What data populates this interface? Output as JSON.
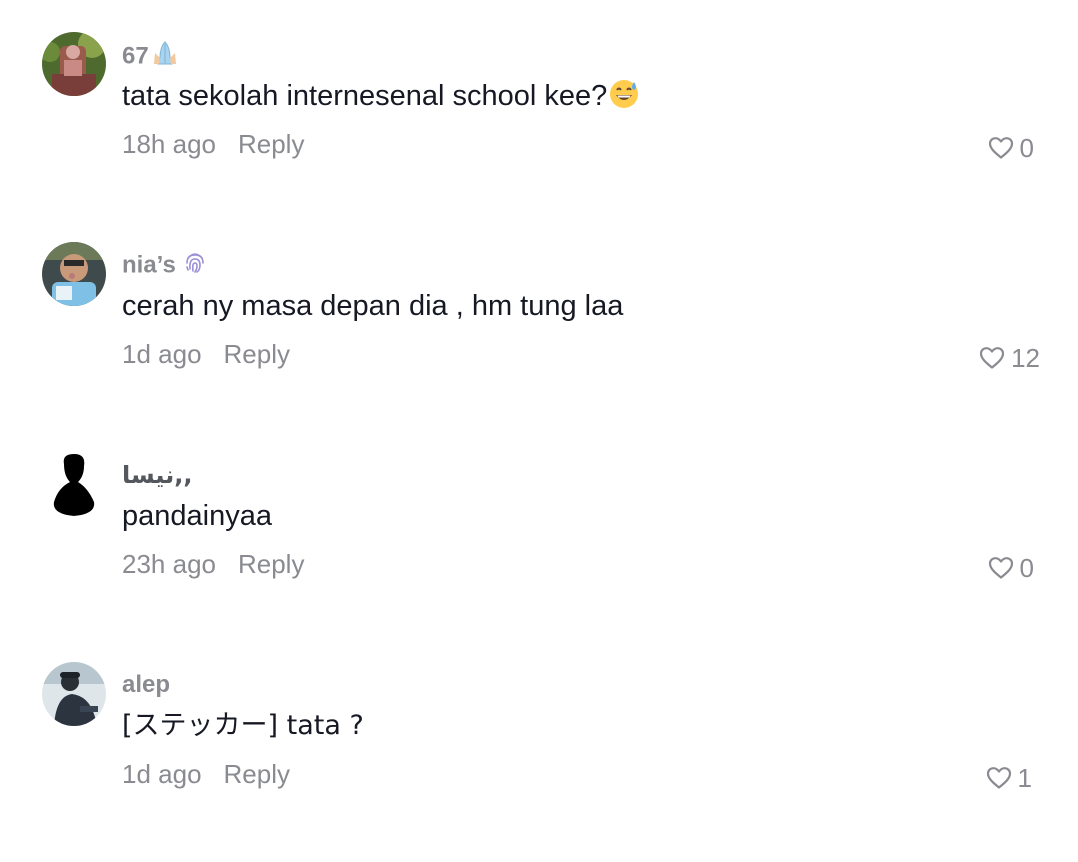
{
  "comments": [
    {
      "username": "67",
      "username_emoji": "praying-hands-icon",
      "text": "tata sekolah internesenal school kee?",
      "text_emoji": "grinning-sweat-icon",
      "time": "18h ago",
      "reply_label": "Reply",
      "like_count": "0"
    },
    {
      "username": "nia’s",
      "username_emoji": "fingerprint-icon",
      "text": "cerah ny masa depan dia , hm tung laa",
      "time": "1d ago",
      "reply_label": "Reply",
      "like_count": "12"
    },
    {
      "username": "نيسا,,",
      "text": "pandainyaa",
      "time": "23h ago",
      "reply_label": "Reply",
      "like_count": "0"
    },
    {
      "username": "alep",
      "text": "[ステッカー] tata ?",
      "time": "1d ago",
      "reply_label": "Reply",
      "like_count": "1"
    }
  ],
  "colors": {
    "text_primary": "#161823",
    "text_secondary": "#8a8b91",
    "background": "#ffffff"
  }
}
